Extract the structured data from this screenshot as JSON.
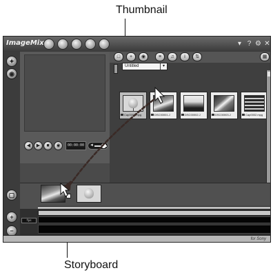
{
  "callouts": {
    "top": "Thumbnail",
    "bottom": "Storyboard"
  },
  "app": {
    "logo": "ImageMixer",
    "window_icons": [
      "minimize-icon",
      "help-icon",
      "settings-icon",
      "close-icon"
    ]
  },
  "preview": {
    "timecode": "00:00:00"
  },
  "library": {
    "album": "Untitled",
    "thumbnails": [
      {
        "name": "Cap0001.mpg",
        "selected": true
      },
      {
        "name": "DSC00001.J",
        "selected": false
      },
      {
        "name": "DSC00002.J",
        "selected": false
      },
      {
        "name": "DSC00003.J",
        "selected": false
      },
      {
        "name": "Cap0002.mpg",
        "selected": false
      }
    ]
  },
  "timeline": {
    "fps_label": "fps"
  },
  "status": {
    "brand": "for Sony"
  },
  "colors": {
    "chrome": "#4a4a4a",
    "panel": "#3f3f3f",
    "drag_path": "#3a2a26"
  }
}
